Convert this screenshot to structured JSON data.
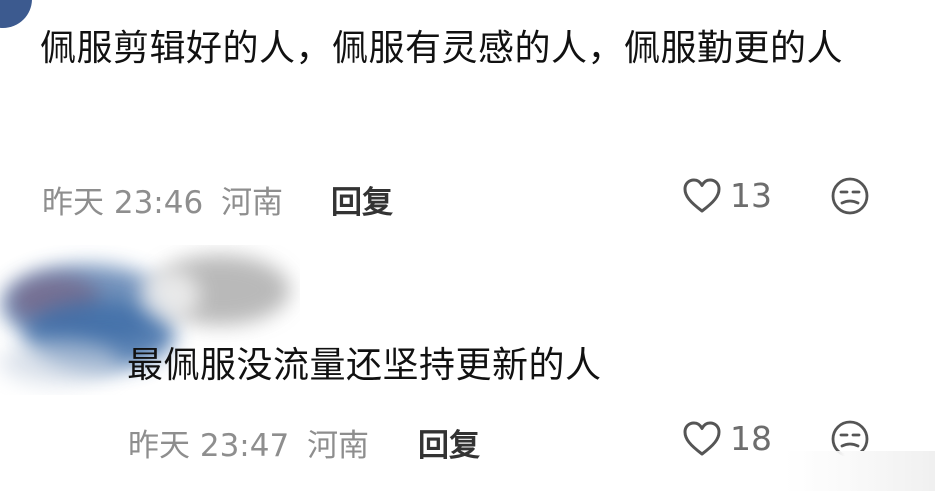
{
  "comments": [
    {
      "text": "佩服剪辑好的人，佩服有灵感的人，佩服勤更的人",
      "time": "昨天 23:46",
      "location": "河南",
      "reply_label": "回复",
      "like_count": "13",
      "icons": {
        "like": "heart-outline-icon",
        "dislike": "frown-face-icon"
      }
    },
    {
      "text": "最佩服没流量还坚持更新的人",
      "time": "昨天 23:47",
      "location": "河南",
      "reply_label": "回复",
      "like_count": "18",
      "icons": {
        "like": "heart-outline-icon",
        "dislike": "frown-face-icon"
      }
    }
  ],
  "colors": {
    "text": "#111111",
    "meta": "#8e8e8e",
    "reply": "#333333",
    "icon": "#555555",
    "avatar": "#3c5a8f"
  }
}
